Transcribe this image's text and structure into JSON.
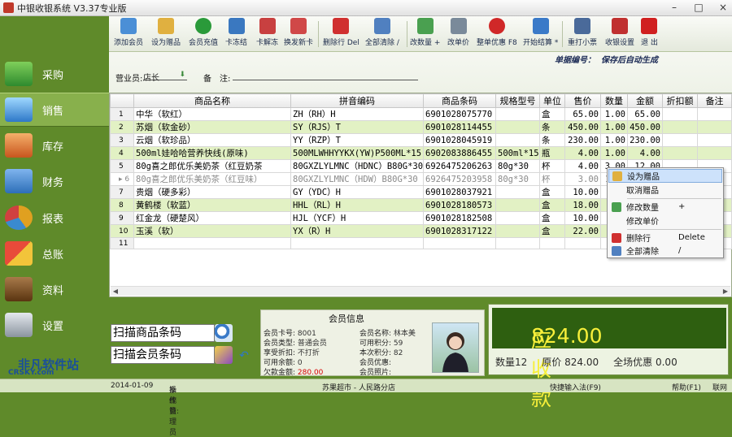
{
  "window": {
    "title": "中银收银系统 V3.37专业版",
    "buttons": [
      "–",
      "□",
      "×"
    ]
  },
  "sidebar": {
    "items": [
      {
        "label": "采购",
        "icon": "truck-icon",
        "color": "#3c9a3c"
      },
      {
        "label": "销售",
        "icon": "monitor-icon",
        "color": "#2e78c8"
      },
      {
        "label": "库存",
        "icon": "warehouse-icon",
        "color": "#d8662a"
      },
      {
        "label": "财务",
        "icon": "money-icon",
        "color": "#2d6fb8"
      },
      {
        "label": "报表",
        "icon": "pie-chart-icon",
        "color": "#e0a020"
      },
      {
        "label": "总账",
        "icon": "blocks-icon",
        "color": "#c03a2a"
      },
      {
        "label": "资料",
        "icon": "books-icon",
        "color": "#7a4a20"
      },
      {
        "label": "设置",
        "icon": "tools-icon",
        "color": "#9aa4b0"
      }
    ],
    "active": 1
  },
  "watermark": {
    "line1": "非凡软件站",
    "line2": "CRSKY.com"
  },
  "toolbar": {
    "items": [
      {
        "label": "添加会员",
        "icon": "add-member-icon",
        "color": "#4b8fd6"
      },
      {
        "label": "设为赠品",
        "icon": "gift-icon",
        "color": "#e0b040"
      },
      {
        "label": "会员充值",
        "icon": "euro-icon",
        "color": "#2a9a3a"
      },
      {
        "label": "卡冻结",
        "icon": "card-freeze-icon",
        "color": "#3a78c0"
      },
      {
        "label": "卡解冻",
        "icon": "card-unfreeze-icon",
        "color": "#c84040"
      },
      {
        "label": "换发新卡",
        "icon": "new-card-icon",
        "color": "#d04848"
      },
      {
        "label": "删除行 Del",
        "icon": "delete-row-icon",
        "color": "#d03030"
      },
      {
        "label": "全部清除 /",
        "icon": "clear-all-icon",
        "color": "#5080c0"
      },
      {
        "label": "改数量 +",
        "icon": "edit-qty-icon",
        "color": "#4aa050"
      },
      {
        "label": "改单价",
        "icon": "edit-price-icon",
        "color": "#7a8a9a"
      },
      {
        "label": "整单优惠 F8",
        "icon": "discount-heart-icon",
        "color": "#d02828"
      },
      {
        "label": "开始结算 *",
        "icon": "checkout-icon",
        "color": "#3a7ac8"
      },
      {
        "label": "重打小票",
        "icon": "reprint-icon",
        "color": "#4a6a9a"
      },
      {
        "label": "收银设置",
        "icon": "settings-icon",
        "color": "#c03030"
      },
      {
        "label": "退 出",
        "icon": "exit-icon",
        "color": "#d02020"
      }
    ]
  },
  "header": {
    "ticket_label": "单据编号：",
    "ticket_value": "保存后自动生成",
    "salesperson_label": "营业员:",
    "salesperson_value": "店长",
    "remark_label": "备　注:",
    "remark_value": ""
  },
  "grid": {
    "columns": [
      "",
      "商品名称",
      "拼音编码",
      "商品条码",
      "规格型号",
      "单位",
      "售价",
      "数量",
      "金额",
      "折扣额",
      "备注"
    ],
    "rows": [
      [
        "1",
        "中华（软红）",
        "ZH（RH）H",
        "6901028075770",
        "",
        "盒",
        "65.00",
        "1.00",
        "65.00",
        "",
        ""
      ],
      [
        "2",
        "苏烟（软金砂）",
        "SY（RJS）T",
        "6901028114455",
        "",
        "条",
        "450.00",
        "1.00",
        "450.00",
        "",
        ""
      ],
      [
        "3",
        "云烟（软珍品）",
        "YY（RZP）T",
        "6901028045919",
        "",
        "条",
        "230.00",
        "1.00",
        "230.00",
        "",
        ""
      ],
      [
        "4",
        "500ml娃哈哈营养快线(原味)",
        "500MLWHHYYKX(YW)P500ML*15",
        "6902083886455",
        "500ml*15",
        "瓶",
        "4.00",
        "1.00",
        "4.00",
        "",
        ""
      ],
      [
        "5",
        "80g喜之郎优乐美奶茶（红豆奶茶",
        "80GXZLYLMNC（HDNC）B80G*30",
        "6926475206263",
        "80g*30",
        "杯",
        "4.00",
        "3.00",
        "12.00",
        "",
        ""
      ],
      [
        "▸ 6",
        "80g喜之郎优乐美奶茶（红豆味）",
        "80GXZLYLMNC（HDW）B80G*30",
        "6926475203958",
        "80g*30",
        "杯",
        "3.00",
        "1.00",
        "",
        "",
        ""
      ],
      [
        "7",
        "贵烟（硬多彩）",
        "GY（YDC）H",
        "6901028037921",
        "",
        "盒",
        "10.00",
        "",
        "",
        "",
        ""
      ],
      [
        "8",
        "黄鹤楼（软蓝）",
        "HHL（RL）H",
        "6901028180573",
        "",
        "盒",
        "18.00",
        "",
        "",
        "",
        ""
      ],
      [
        "9",
        "红金龙（硬楚风）",
        "HJL（YCF）H",
        "6901028182508",
        "",
        "盒",
        "10.00",
        "",
        "",
        "",
        ""
      ],
      [
        "10",
        "玉溪（软）",
        "YX（R）H",
        "6901028317122",
        "",
        "盒",
        "22.00",
        "",
        "",
        "",
        ""
      ],
      [
        "11",
        "",
        "",
        "",
        "",
        "",
        "",
        "",
        "",
        "",
        ""
      ]
    ]
  },
  "context_menu": {
    "items": [
      {
        "label": "设为赠品",
        "shortcut": "",
        "icon": "gift-icon",
        "highlight": true
      },
      {
        "label": "取消赠品",
        "shortcut": "",
        "icon": "",
        "highlight": false
      },
      {
        "label": "修改数量",
        "shortcut": "+",
        "icon": "edit-qty-icon",
        "highlight": false
      },
      {
        "label": "修改单价",
        "shortcut": "",
        "icon": "",
        "highlight": false
      },
      {
        "label": "删除行",
        "shortcut": "Delete",
        "icon": "delete-row-icon",
        "highlight": false
      },
      {
        "label": "全部清除",
        "shortcut": "/",
        "icon": "clear-all-icon",
        "highlight": false
      }
    ]
  },
  "scan": {
    "product_placeholder": "扫描商品条码",
    "member_placeholder": "扫描会员条码"
  },
  "member": {
    "title": "会员信息",
    "card_no_label": "会员卡号:",
    "card_no": "8001",
    "type_label": "会员类型:",
    "type": "普通会员",
    "discount_label": "享受折扣:",
    "discount": "不打折",
    "balance_label": "可用余额:",
    "balance": "0",
    "owed_label": "欠款金额:",
    "owed": "280.00",
    "name_label": "会员名称:",
    "name": "林本美",
    "points_label": "可用积分:",
    "points": "59",
    "this_points_label": "本次积分:",
    "this_points": "82",
    "offer_label": "会员优惠:",
    "offer": "",
    "photo_label": "会员照片:"
  },
  "totals": {
    "receivable_label": "应收款",
    "receivable": "824.00",
    "qty_label": "数量",
    "qty": "12",
    "orig_label": "原价",
    "orig": "824.00",
    "discount_label": "全场优惠",
    "discount": "0.00"
  },
  "status": {
    "date": "2014-01-09",
    "operator_label": "操作员:",
    "operator": "系统管理员",
    "store": "苏果超市 - 人民路分店",
    "hint": "快捷输入法(F9)",
    "help": "帮助(F1)",
    "online": "联网"
  }
}
